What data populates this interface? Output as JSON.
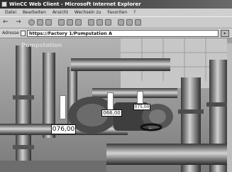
{
  "window": {
    "title": "WinCC Web Client - Microsoft Internet Explorer"
  },
  "menu": {
    "items": [
      "Datei",
      "Bearbeiten",
      "Ansicht",
      "Wechseln zu",
      "Favoriten",
      "?"
    ]
  },
  "address": {
    "label": "Adresse",
    "url": "https://Factory 1/Pumpstation A"
  },
  "page": {
    "title": "Pumpstation"
  },
  "readouts": [
    {
      "label": "076,00"
    },
    {
      "label": "066,00"
    },
    {
      "label": "075,00"
    }
  ]
}
